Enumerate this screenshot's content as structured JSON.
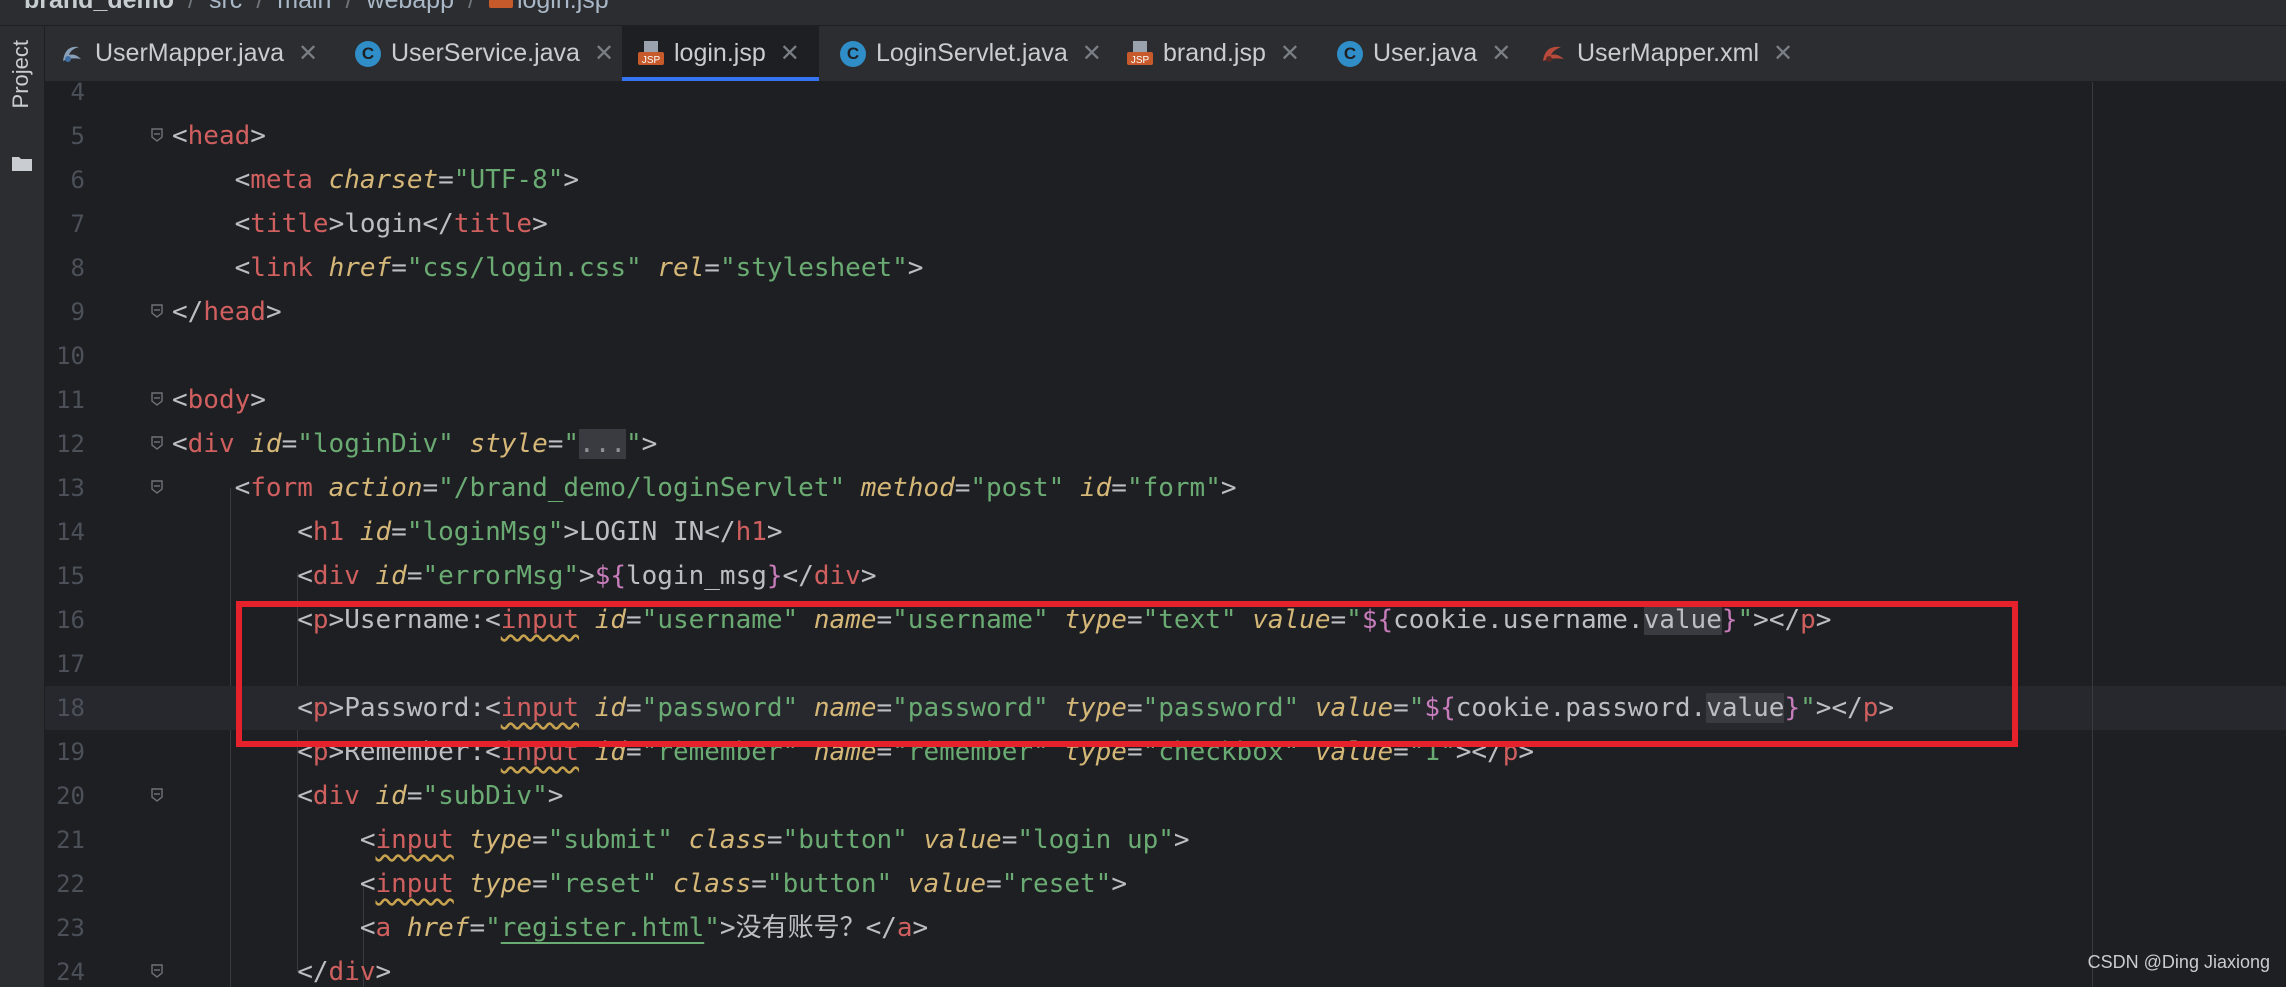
{
  "breadcrumb": {
    "items": [
      "brand_demo",
      "src",
      "main",
      "webapp",
      "login.jsp"
    ]
  },
  "sidebar": {
    "project_label": "Project"
  },
  "tabs": [
    {
      "label": "UserMapper.java",
      "icon": "mybatis-mapper-icon",
      "active": false
    },
    {
      "label": "UserService.java",
      "icon": "class-icon",
      "active": false
    },
    {
      "label": "login.jsp",
      "icon": "jsp-file-icon",
      "active": true
    },
    {
      "label": "LoginServlet.java",
      "icon": "class-icon",
      "active": false
    },
    {
      "label": "brand.jsp",
      "icon": "jsp-file-icon",
      "active": false
    },
    {
      "label": "User.java",
      "icon": "class-icon",
      "active": false
    },
    {
      "label": "UserMapper.xml",
      "icon": "mybatis-xml-icon",
      "active": false
    }
  ],
  "editor": {
    "line_numbers": [
      "4",
      "5",
      "6",
      "7",
      "8",
      "9",
      "10",
      "11",
      "12",
      "13",
      "14",
      "15",
      "16",
      "17",
      "18",
      "19",
      "20",
      "21",
      "22",
      "23",
      "24"
    ],
    "lines": [
      "",
      "<head>",
      "    <meta charset=\"UTF-8\">",
      "    <title>login</title>",
      "    <link href=\"css/login.css\" rel=\"stylesheet\">",
      "</head>",
      "",
      "<body>",
      "<div id=\"loginDiv\" style=\"...\">",
      "    <form action=\"/brand_demo/loginServlet\" method=\"post\" id=\"form\">",
      "        <h1 id=\"loginMsg\">LOGIN IN</h1>",
      "        <div id=\"errorMsg\">${login_msg}</div>",
      "        <p>Username:<input id=\"username\" name=\"username\" type=\"text\" value=\"${cookie.username.value}\"></p>",
      "",
      "        <p>Password:<input id=\"password\" name=\"password\" type=\"password\" value=\"${cookie.password.value}\"></p>",
      "        <p>Remember:<input id=\"remember\" name=\"remember\" type=\"checkbox\" value=\"1\"></p>",
      "        <div id=\"subDiv\">",
      "            <input type=\"submit\" class=\"button\" value=\"login up\">",
      "            <input type=\"reset\" class=\"button\" value=\"reset\">",
      "            <a href=\"register.html\">没有账号？</a>",
      "        </div>"
    ],
    "caret_line": "18"
  },
  "watermark": "CSDN @Ding Jiaxiong",
  "colors": {
    "background": "#1e1f22",
    "tab_bar": "#2b2d30",
    "active_tab_underline": "#3574f0",
    "tag": "#d5b778",
    "attribute_value": "#6aab73",
    "highlight_box": "#e5212b"
  }
}
